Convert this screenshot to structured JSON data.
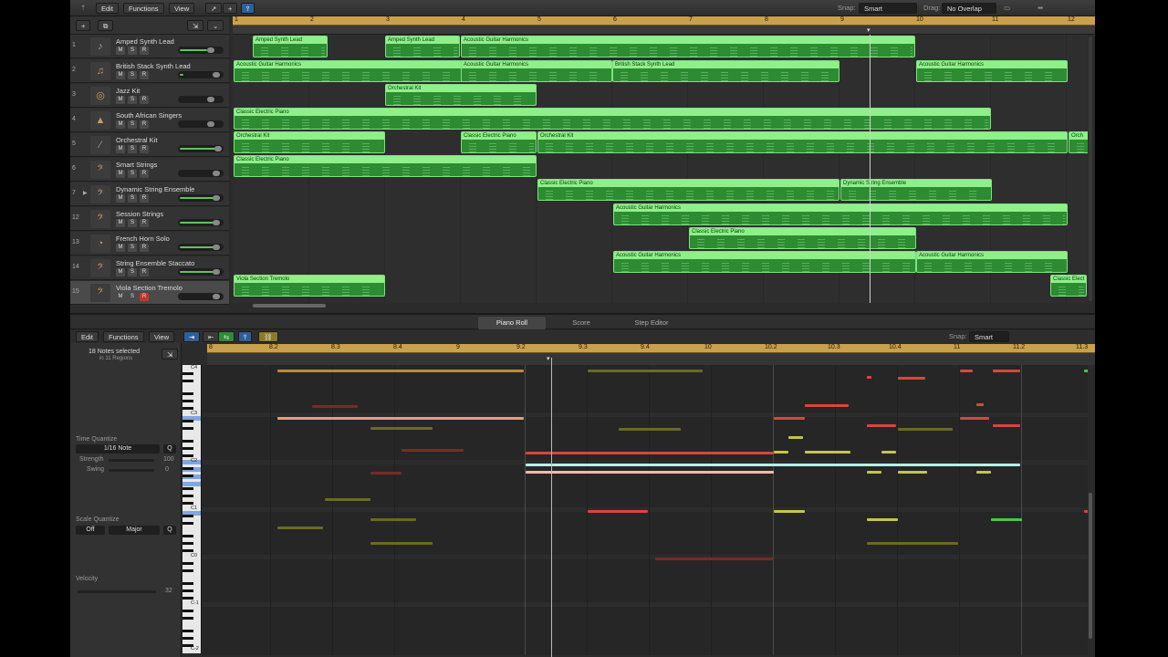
{
  "toolbar": {
    "edit": "Edit",
    "functions": "Functions",
    "view": "View",
    "snap_label": "Snap:",
    "snap_value": "Smart",
    "drag_label": "Drag:",
    "drag_value": "No Overlap"
  },
  "ruler": [
    "1",
    "2",
    "3",
    "4",
    "5",
    "6",
    "7",
    "8",
    "9",
    "10",
    "11",
    "12"
  ],
  "tracks": [
    {
      "num": "1",
      "name": "Amped Synth Lead",
      "icon": "synth-icon"
    },
    {
      "num": "2",
      "name": "British Stack Synth Lead",
      "icon": "synth-icon"
    },
    {
      "num": "3",
      "name": "Jazz Kit",
      "icon": "drum-kit-icon"
    },
    {
      "num": "4",
      "name": "South African Singers",
      "icon": "choir-icon"
    },
    {
      "num": "5",
      "name": "Orchestral Kit",
      "icon": "drumsticks-icon"
    },
    {
      "num": "6",
      "name": "Smart Strings",
      "icon": "strings-icon"
    },
    {
      "num": "7",
      "name": "Dynamic String Ensemble",
      "icon": "strings-icon"
    },
    {
      "num": "12",
      "name": "Session Strings",
      "icon": "strings-icon"
    },
    {
      "num": "13",
      "name": "French Horn Solo",
      "icon": "horn-icon"
    },
    {
      "num": "14",
      "name": "String Ensemble Staccato",
      "icon": "strings-icon"
    },
    {
      "num": "15",
      "name": "Viola Section Tremolo",
      "icon": "viola-icon"
    }
  ],
  "msr": {
    "m": "M",
    "s": "S",
    "r": "R"
  },
  "regions": [
    [
      "Amped Synth Lead",
      "Amped Synth Lead",
      "Acoustic Guitar Harmonics"
    ],
    [
      "Acoustic Guitar Harmonics",
      "Acoustic Guitar Harmonics",
      "British Stack Synth Lead",
      "Acoustic Guitar Harmonics"
    ],
    [
      "Orchestral Kit"
    ],
    [
      "Classic Electric Piano"
    ],
    [
      "Orchestral Kit",
      "Classic Electric Piano",
      "Orchestral Kit",
      "Orch"
    ],
    [
      "Classic Electric Piano"
    ],
    [
      "Classic Electric Piano",
      "Dynamic String Ensemble"
    ],
    [
      "Acoustic Guitar Harmonics"
    ],
    [
      "Classic Electric Piano"
    ],
    [
      "Acoustic Guitar Harmonics",
      "Acoustic Guitar Harmonics"
    ],
    [
      "Viola Section Tremolo",
      "Classic Elect"
    ]
  ],
  "editor_tabs": {
    "piano_roll": "Piano Roll",
    "score": "Score",
    "step_editor": "Step Editor"
  },
  "editor_toolbar": {
    "edit": "Edit",
    "functions": "Functions",
    "view": "View",
    "snap_label": "Snap:",
    "snap_value": "Smart"
  },
  "inspector": {
    "selection": "18 Notes selected",
    "selection_sub": "in 11 Regions",
    "time_quantize": "Time Quantize",
    "quantize_value": "1/16 Note",
    "q": "Q",
    "strength": "Strength",
    "strength_value": "100",
    "swing": "Swing",
    "swing_value": "0",
    "scale_quantize": "Scale Quantize",
    "scale_off": "Off",
    "scale_mode": "Major",
    "velocity": "Velocity",
    "velocity_value": "32"
  },
  "pr_ruler": [
    "8",
    "8.2",
    "8.3",
    "8.4",
    "9",
    "9.2",
    "9.3",
    "9.4",
    "10",
    "10.2",
    "10.3",
    "10.4",
    "11",
    "11.2",
    "11.3"
  ],
  "keyboard_labels": [
    "C4",
    "C3",
    "C2",
    "C1",
    "C0",
    "C-1",
    "C-2"
  ],
  "colors": {
    "region": "#2d8c32",
    "region_title": "#8ff08a",
    "ruler": "#c9a04b"
  }
}
